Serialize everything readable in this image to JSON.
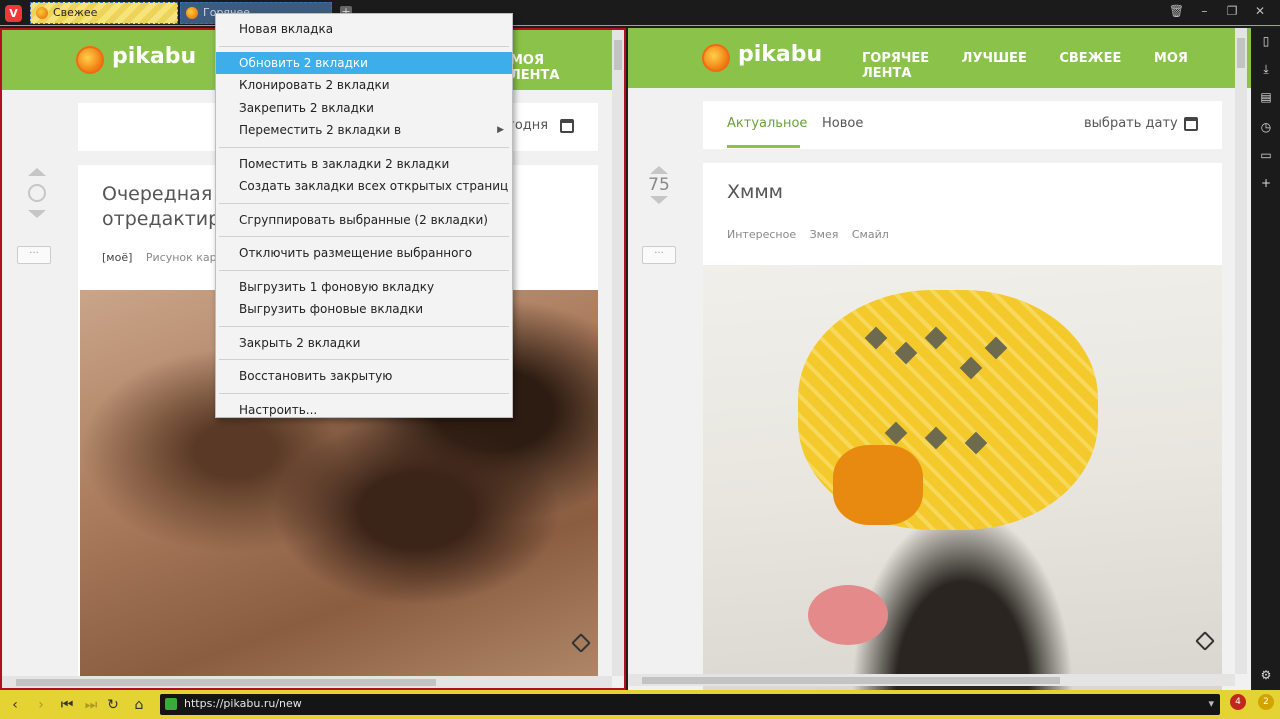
{
  "tabbar": {
    "logo": "V",
    "tabs": [
      {
        "label": "Свежее",
        "favicon": "pikabu-icon"
      },
      {
        "label": "Горячее",
        "favicon": "pikabu-icon"
      }
    ],
    "new_tab": "+",
    "window_buttons": [
      "🗑",
      "–",
      "❐",
      "✕"
    ]
  },
  "context_menu": {
    "items": [
      {
        "label": "Новая вкладка"
      },
      "sep",
      {
        "label": "Обновить 2 вкладки",
        "highlighted": true
      },
      {
        "label": "Клонировать 2 вкладки"
      },
      {
        "label": "Закрепить 2 вкладки"
      },
      {
        "label": "Переместить 2 вкладки в",
        "submenu": true
      },
      "sep",
      {
        "label": "Поместить в закладки 2 вкладки"
      },
      {
        "label": "Создать закладки всех открытых страниц"
      },
      "sep",
      {
        "label": "Сгруппировать выбранные (2 вкладки)"
      },
      "sep",
      {
        "label": "Отключить размещение выбранного"
      },
      "sep",
      {
        "label": "Выгрузить 1 фоновую вкладку"
      },
      {
        "label": "Выгрузить фоновые вкладки"
      },
      "sep",
      {
        "label": "Закрыть 2 вкладки"
      },
      "sep",
      {
        "label": "Восстановить закрытую"
      },
      "sep",
      {
        "label": "Настроить..."
      }
    ],
    "submenu_arrow": "▶"
  },
  "left": {
    "brand": "pikabu",
    "nav_visible": "МОЯ ЛЕНТА",
    "date_partial": "годня",
    "vote_more": "···",
    "post_title": "Очередная эк… отредактиро…",
    "post_title_line1": "Очередная эк",
    "post_title_line2": "отредактиро",
    "tags": [
      "[моё]",
      "Рисунок кара"
    ]
  },
  "right": {
    "brand": "pikabu",
    "nav": [
      "ГОРЯЧЕЕ",
      "ЛУЧШЕЕ",
      "СВЕЖЕЕ",
      "МОЯ ЛЕНТА"
    ],
    "tabs": [
      "Актуальное",
      "Новое"
    ],
    "date_label": "выбрать дату",
    "rating": "75",
    "vote_more": "···",
    "post_title": "Хммм",
    "tags": [
      "Интересное",
      "Змея",
      "Смайл"
    ]
  },
  "addressbar": {
    "url": "https://pikabu.ru/new",
    "dropdown": "▾",
    "badge_count": "4",
    "notif_count": "2"
  },
  "colors": {
    "pikabu_green": "#8bc34a",
    "accent_yellow": "#e5d233",
    "highlight_blue": "#3daee9"
  }
}
